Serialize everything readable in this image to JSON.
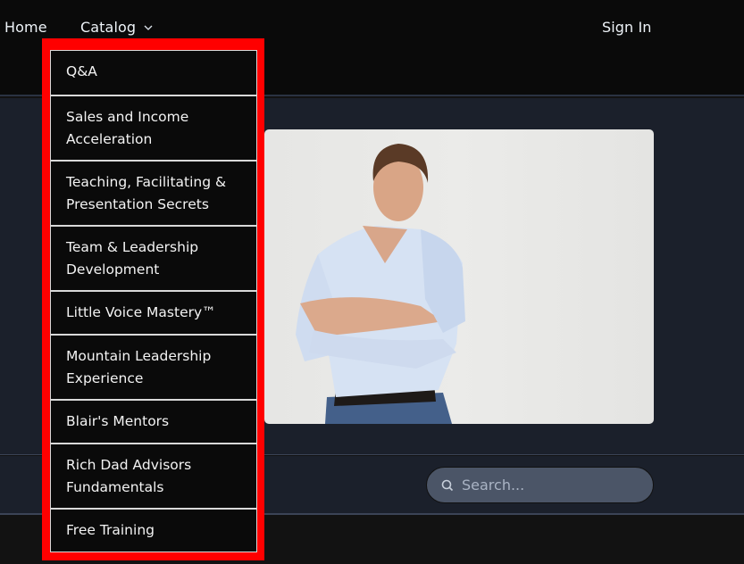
{
  "nav": {
    "home_label": "Home",
    "catalog_label": "Catalog",
    "signin_label": "Sign In"
  },
  "dropdown": {
    "items": [
      {
        "label": "Q&A"
      },
      {
        "label": "Sales and Income Acceleration"
      },
      {
        "label": "Teaching, Facilitating & Presentation Secrets"
      },
      {
        "label": "Team & Leadership Development"
      },
      {
        "label": "Little Voice Mastery™"
      },
      {
        "label": "Mountain Leadership Experience"
      },
      {
        "label": "Blair's Mentors"
      },
      {
        "label": "Rich Dad Advisors Fundamentals"
      },
      {
        "label": "Free Training"
      }
    ]
  },
  "hero": {
    "image_alt": "Smiling man in light blue shirt with arms crossed"
  },
  "search": {
    "placeholder": "Search...",
    "value": ""
  },
  "colors": {
    "highlight": "#ff0000",
    "topbar": "#0a0a0a",
    "hero_bg": "#1b202b",
    "search_bg": "#4b5567"
  }
}
